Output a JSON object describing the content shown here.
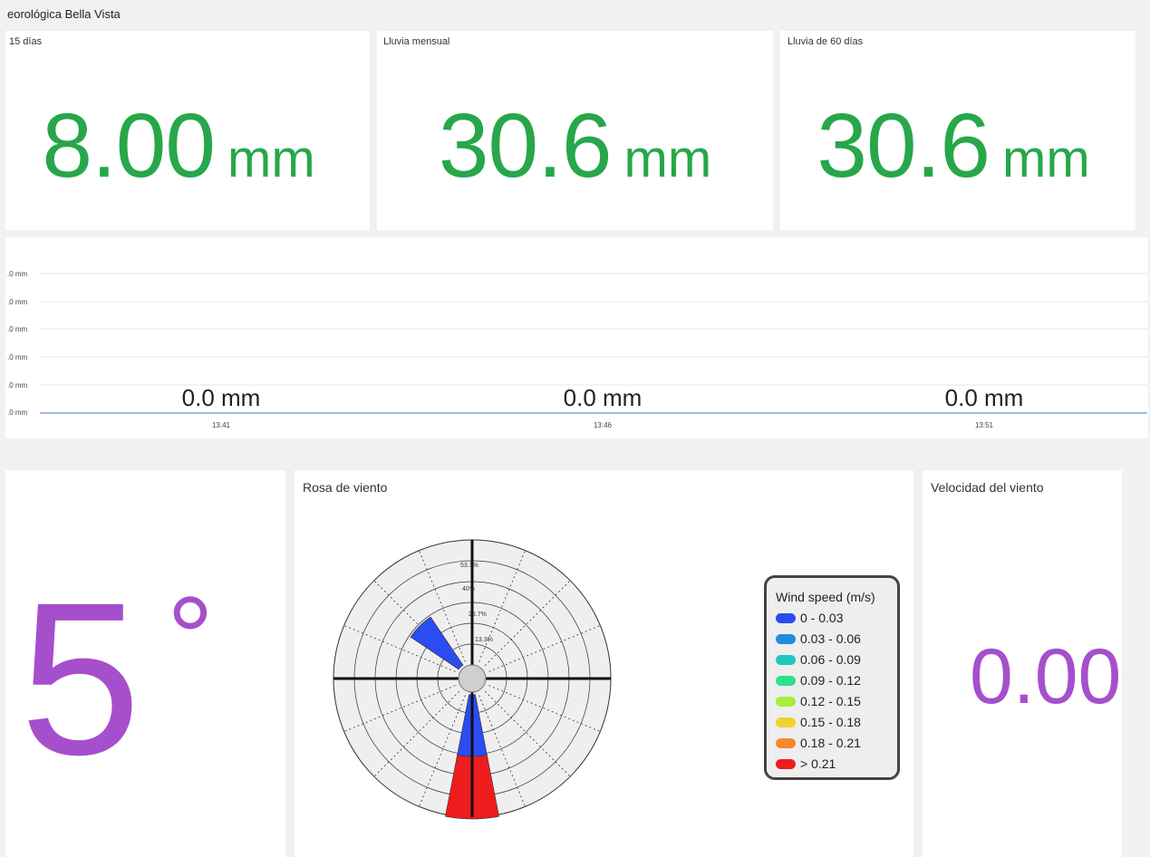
{
  "dashboard": {
    "title": "eorológica Bella Vista"
  },
  "stats": [
    {
      "title": "15 días",
      "value": "8.00",
      "unit": "mm"
    },
    {
      "title": "Lluvia mensual",
      "value": "30.6",
      "unit": "mm"
    },
    {
      "title": "Lluvia de 60 días",
      "value": "30.6",
      "unit": "mm"
    }
  ],
  "rain_graph": {
    "y_ticks": [
      ".0 mm",
      ".0 mm",
      ".0 mm",
      ".0 mm",
      ".0 mm",
      ".0 mm"
    ],
    "x_ticks": [
      "13:41",
      "13:46",
      "13:51"
    ],
    "values": [
      "0.0 mm",
      "0.0 mm",
      "0.0 mm"
    ],
    "line_color": "#4b8bd6"
  },
  "wind_direction": {
    "value": "5",
    "unit": "°",
    "color": "#a64fcc"
  },
  "wind_rose": {
    "title": "Rosa de viento",
    "rings": [
      "53.3%",
      "40%",
      "26.7%",
      "13.3%"
    ],
    "legend": {
      "title": "Wind speed (m/s)",
      "items": [
        {
          "label": "0 - 0.03",
          "color": "#2b4cf0"
        },
        {
          "label": "0.03 - 0.06",
          "color": "#1e8fd8"
        },
        {
          "label": "0.06 - 0.09",
          "color": "#1ec9c0"
        },
        {
          "label": "0.09 - 0.12",
          "color": "#2fe08a"
        },
        {
          "label": "0.12 - 0.15",
          "color": "#a6ee3a"
        },
        {
          "label": "0.15 - 0.18",
          "color": "#f2d22a"
        },
        {
          "label": "0.18 - 0.21",
          "color": "#f58a2a"
        },
        {
          "label": "> 0.21",
          "color": "#ee1c1c"
        }
      ]
    }
  },
  "wind_speed": {
    "title": "Velocidad del viento",
    "value": "0.00",
    "color": "#a64fcc"
  }
}
